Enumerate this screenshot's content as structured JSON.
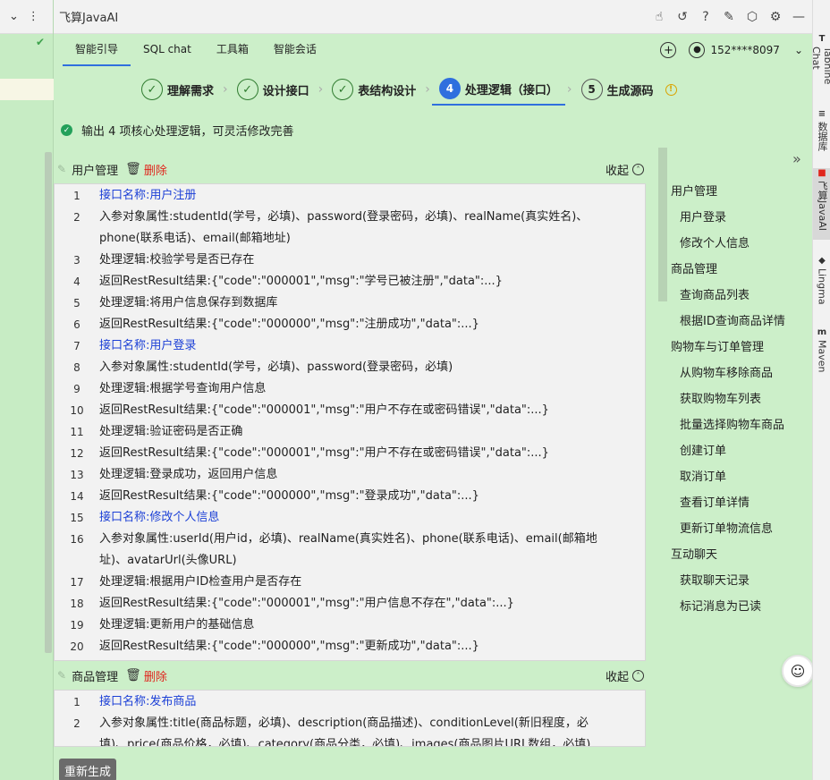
{
  "window": {
    "title": "飞算JavaAI"
  },
  "nav": {
    "tabs": [
      "智能引导",
      "SQL chat",
      "工具箱",
      "智能会话"
    ],
    "active_tab": 0,
    "user": "152****8097"
  },
  "steps": [
    {
      "num": "✓",
      "label": "理解需求",
      "state": "done"
    },
    {
      "num": "✓",
      "label": "设计接口",
      "state": "done"
    },
    {
      "num": "✓",
      "label": "表结构设计",
      "state": "done"
    },
    {
      "num": "4",
      "label": "处理逻辑（接口）",
      "state": "active"
    },
    {
      "num": "5",
      "label": "生成源码",
      "state": "todo"
    }
  ],
  "notice": "输出 4 项核心处理逻辑，可灵活修改完善",
  "sections": [
    {
      "name": "用户管理",
      "delete_label": "删除",
      "collapse_label": "收起",
      "lines": [
        {
          "n": "1",
          "text": "接口名称:用户注册",
          "api": true
        },
        {
          "n": "2",
          "text": "入参对象属性:studentId(学号，必填)、password(登录密码，必填)、realName(真实姓名)、",
          "api": false
        },
        {
          "n": "",
          "text": "phone(联系电话)、email(邮箱地址)",
          "api": false
        },
        {
          "n": "3",
          "text": "处理逻辑:校验学号是否已存在",
          "api": false
        },
        {
          "n": "4",
          "text": "返回RestResult结果:{\"code\":\"000001\",\"msg\":\"学号已被注册\",\"data\":...}",
          "api": false
        },
        {
          "n": "5",
          "text": "处理逻辑:将用户信息保存到数据库",
          "api": false
        },
        {
          "n": "6",
          "text": "返回RestResult结果:{\"code\":\"000000\",\"msg\":\"注册成功\",\"data\":...}",
          "api": false
        },
        {
          "n": "7",
          "text": "接口名称:用户登录",
          "api": true
        },
        {
          "n": "8",
          "text": "入参对象属性:studentId(学号，必填)、password(登录密码，必填)",
          "api": false
        },
        {
          "n": "9",
          "text": "处理逻辑:根据学号查询用户信息",
          "api": false
        },
        {
          "n": "10",
          "text": "返回RestResult结果:{\"code\":\"000001\",\"msg\":\"用户不存在或密码错误\",\"data\":...}",
          "api": false
        },
        {
          "n": "11",
          "text": "处理逻辑:验证密码是否正确",
          "api": false
        },
        {
          "n": "12",
          "text": "返回RestResult结果:{\"code\":\"000001\",\"msg\":\"用户不存在或密码错误\",\"data\":...}",
          "api": false
        },
        {
          "n": "13",
          "text": "处理逻辑:登录成功，返回用户信息",
          "api": false
        },
        {
          "n": "14",
          "text": "返回RestResult结果:{\"code\":\"000000\",\"msg\":\"登录成功\",\"data\":...}",
          "api": false
        },
        {
          "n": "15",
          "text": "接口名称:修改个人信息",
          "api": true
        },
        {
          "n": "16",
          "text": "入参对象属性:userId(用户id，必填)、realName(真实姓名)、phone(联系电话)、email(邮箱地",
          "api": false
        },
        {
          "n": "",
          "text": "址)、avatarUrl(头像URL)",
          "api": false
        },
        {
          "n": "17",
          "text": "处理逻辑:根据用户ID检查用户是否存在",
          "api": false
        },
        {
          "n": "18",
          "text": "返回RestResult结果:{\"code\":\"000001\",\"msg\":\"用户信息不存在\",\"data\":...}",
          "api": false
        },
        {
          "n": "19",
          "text": "处理逻辑:更新用户的基础信息",
          "api": false
        },
        {
          "n": "20",
          "text": "返回RestResult结果:{\"code\":\"000000\",\"msg\":\"更新成功\",\"data\":...}",
          "api": false
        }
      ]
    },
    {
      "name": "商品管理",
      "delete_label": "删除",
      "collapse_label": "收起",
      "lines": [
        {
          "n": "1",
          "text": "接口名称:发布商品",
          "api": true
        },
        {
          "n": "2",
          "text": "入参对象属性:title(商品标题，必填)、description(商品描述)、conditionLevel(新旧程度，必",
          "api": false
        },
        {
          "n": "",
          "text": "填)、price(商品价格，必填)、category(商品分类，必填)、images(商品图片URL数组，必填)",
          "api": false
        }
      ]
    }
  ],
  "toc": [
    {
      "label": "用户管理",
      "sub": false
    },
    {
      "label": "用户登录",
      "sub": true
    },
    {
      "label": "修改个人信息",
      "sub": true
    },
    {
      "label": "商品管理",
      "sub": false
    },
    {
      "label": "查询商品列表",
      "sub": true
    },
    {
      "label": "根据ID查询商品详情",
      "sub": true
    },
    {
      "label": "购物车与订单管理",
      "sub": false
    },
    {
      "label": "从购物车移除商品",
      "sub": true
    },
    {
      "label": "获取购物车列表",
      "sub": true
    },
    {
      "label": "批量选择购物车商品",
      "sub": true
    },
    {
      "label": "创建订单",
      "sub": true
    },
    {
      "label": "取消订单",
      "sub": true
    },
    {
      "label": "查看订单详情",
      "sub": true
    },
    {
      "label": "更新订单物流信息",
      "sub": true
    },
    {
      "label": "互动聊天",
      "sub": false
    },
    {
      "label": "获取聊天记录",
      "sub": true
    },
    {
      "label": "标记消息为已读",
      "sub": true
    }
  ],
  "regenerate_label": "重新生成",
  "right_sidebar": [
    {
      "label": "Tabnine Chat",
      "icon": "tabnine-icon"
    },
    {
      "label": "数据库",
      "icon": "database-icon"
    },
    {
      "label": "飞算JavaAI",
      "icon": "feisuan-icon",
      "active": true
    },
    {
      "label": "Lingma",
      "icon": "lingma-icon"
    },
    {
      "label": "Maven",
      "icon": "maven-icon"
    }
  ],
  "colors": {
    "panel_bg": "#ccefc9",
    "accent": "#2f6fde",
    "danger": "#e0261d",
    "api_text": "#1b3fd6",
    "success": "#23a05a"
  }
}
